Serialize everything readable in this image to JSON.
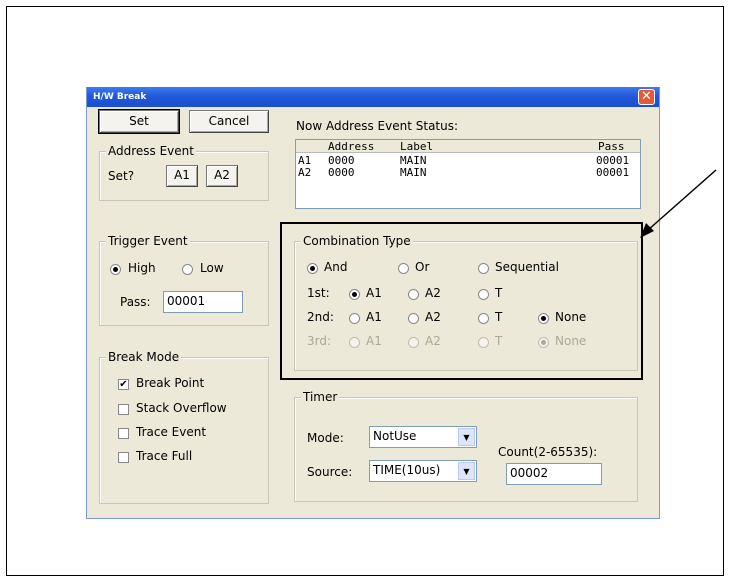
{
  "window": {
    "title": "H/W Break",
    "close_glyph": "✕"
  },
  "buttons": {
    "set": "Set",
    "cancel": "Cancel"
  },
  "address_event": {
    "title": "Address Event",
    "set_label": "Set?",
    "a1": "A1",
    "a2": "A2"
  },
  "status": {
    "title": "Now Address Event Status:",
    "headers": [
      "",
      "Address",
      "Label",
      "Pass"
    ],
    "rows": [
      [
        "A1",
        "0000",
        "MAIN",
        "00001"
      ],
      [
        "A2",
        "0000",
        "MAIN",
        "00001"
      ]
    ]
  },
  "trigger_event": {
    "title": "Trigger Event",
    "high": "High",
    "low": "Low",
    "selected": "High",
    "pass_label": "Pass:",
    "pass_value": "00001"
  },
  "combination": {
    "title": "Combination Type",
    "types": [
      "And",
      "Or",
      "Sequential"
    ],
    "selected_type": "And",
    "rows": [
      {
        "label": "1st:",
        "options": [
          "A1",
          "A2",
          "T"
        ],
        "selected": "A1",
        "enabled": true
      },
      {
        "label": "2nd:",
        "options": [
          "A1",
          "A2",
          "T",
          "None"
        ],
        "selected": "None",
        "enabled": true
      },
      {
        "label": "3rd:",
        "options": [
          "A1",
          "A2",
          "T",
          "None"
        ],
        "selected": "None",
        "enabled": false
      }
    ]
  },
  "break_mode": {
    "title": "Break Mode",
    "items": [
      {
        "label": "Break Point",
        "checked": true
      },
      {
        "label": "Stack Overflow",
        "checked": false
      },
      {
        "label": "Trace Event",
        "checked": false
      },
      {
        "label": "Trace Full",
        "checked": false
      }
    ]
  },
  "timer": {
    "title": "Timer",
    "mode_label": "Mode:",
    "mode_value": "NotUse",
    "source_label": "Source:",
    "source_value": "TIME(10us)",
    "count_label": "Count(2-65535):",
    "count_value": "00002"
  },
  "icons": {
    "combo_arrow": "▼",
    "check_mark": "✔"
  }
}
